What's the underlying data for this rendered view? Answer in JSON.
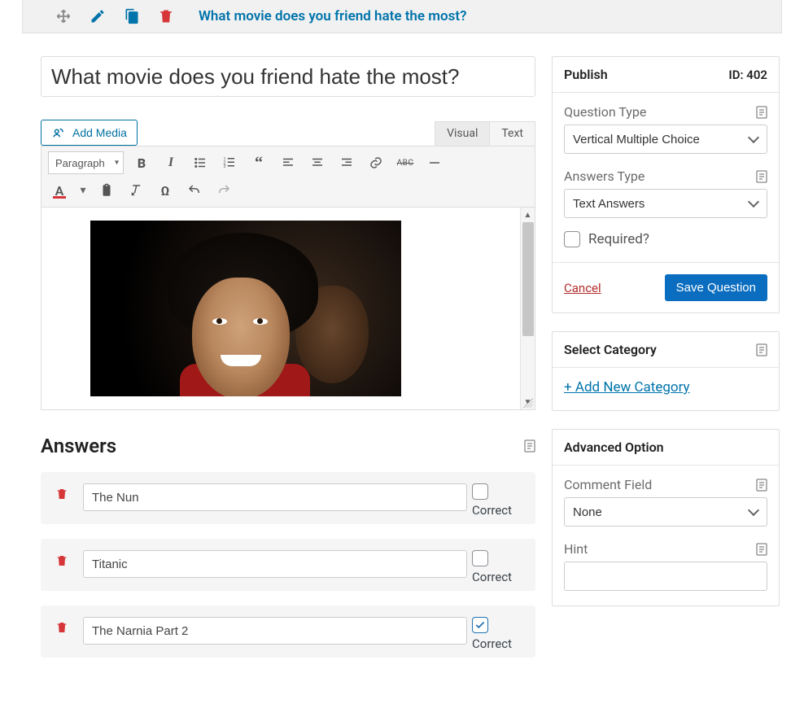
{
  "header": {
    "title": "What movie does you friend hate the most?"
  },
  "question": {
    "title_value": "What movie does you friend hate the most?"
  },
  "editor": {
    "add_media": "Add Media",
    "tabs": {
      "visual": "Visual",
      "text": "Text"
    },
    "format_select": "Paragraph",
    "icons": {
      "bold": "bold-icon",
      "italic": "italic-icon",
      "bullets": "bulleted-list-icon",
      "numbers": "numbered-list-icon",
      "quote": "blockquote-icon",
      "align_left": "align-left-icon",
      "align_center": "align-center-icon",
      "align_right": "align-right-icon",
      "link": "link-icon",
      "abc": "strikethrough-abc-icon",
      "hr": "horizontal-rule-icon",
      "text_color": "text-color-icon",
      "paste": "paste-icon",
      "clear": "clear-format-icon",
      "omega": "special-char-icon",
      "undo": "undo-icon",
      "redo": "redo-icon"
    }
  },
  "answers": {
    "heading": "Answers",
    "correct_label": "Correct",
    "items": [
      {
        "value": "The Nun",
        "correct": false
      },
      {
        "value": "Titanic",
        "correct": false
      },
      {
        "value": "The Narnia Part 2",
        "correct": true
      }
    ]
  },
  "publish": {
    "title": "Publish",
    "id_label": "ID: 402",
    "question_type_label": "Question Type",
    "question_type_value": "Vertical Multiple Choice",
    "answers_type_label": "Answers Type",
    "answers_type_value": "Text Answers",
    "required_label": "Required?",
    "cancel": "Cancel",
    "save": "Save Question"
  },
  "category": {
    "title": "Select Category",
    "add_new": "+ Add New Category"
  },
  "advanced": {
    "title": "Advanced Option",
    "comment_label": "Comment Field",
    "comment_value": "None",
    "hint_label": "Hint",
    "hint_value": ""
  }
}
